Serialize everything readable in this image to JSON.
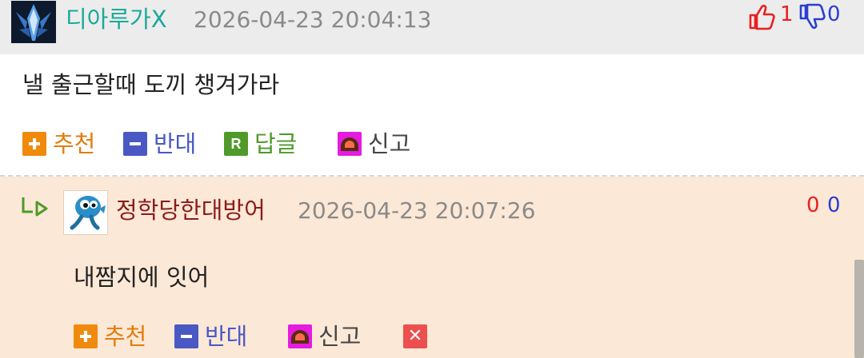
{
  "comment": {
    "author": "디아루가X",
    "datetime": "2026-04-23 20:04:13",
    "upvotes": "1",
    "downvotes": "0",
    "text": "낼 출근할때 도끼 챙겨가라",
    "actions": {
      "recommend": "추천",
      "oppose": "반대",
      "reply": "답글",
      "reply_icon_letter": "R",
      "report": "신고"
    }
  },
  "reply": {
    "author": "정학당한대방어",
    "datetime": "2026-04-23 20:07:26",
    "upvotes": "0",
    "downvotes": "0",
    "text": "내짬지에 잇어",
    "actions": {
      "recommend": "추천",
      "oppose": "반대",
      "report": "신고",
      "delete_icon": "✕"
    }
  },
  "colors": {
    "author_name": "#1aa99a",
    "reply_author_name": "#8b1b1b",
    "header_bg": "#ececec",
    "reply_bg": "#fce8d6",
    "upvote": "#e8201f",
    "downvote": "#2a3fd0",
    "recommend": "#e27d0e",
    "oppose": "#4a58c4",
    "reply_action": "#4f9a2a"
  },
  "icons": [
    "thumbs-up-icon",
    "thumbs-down-icon",
    "plus-icon",
    "minus-icon",
    "reply-icon",
    "siren-icon",
    "reply-arrow-icon",
    "close-icon"
  ]
}
